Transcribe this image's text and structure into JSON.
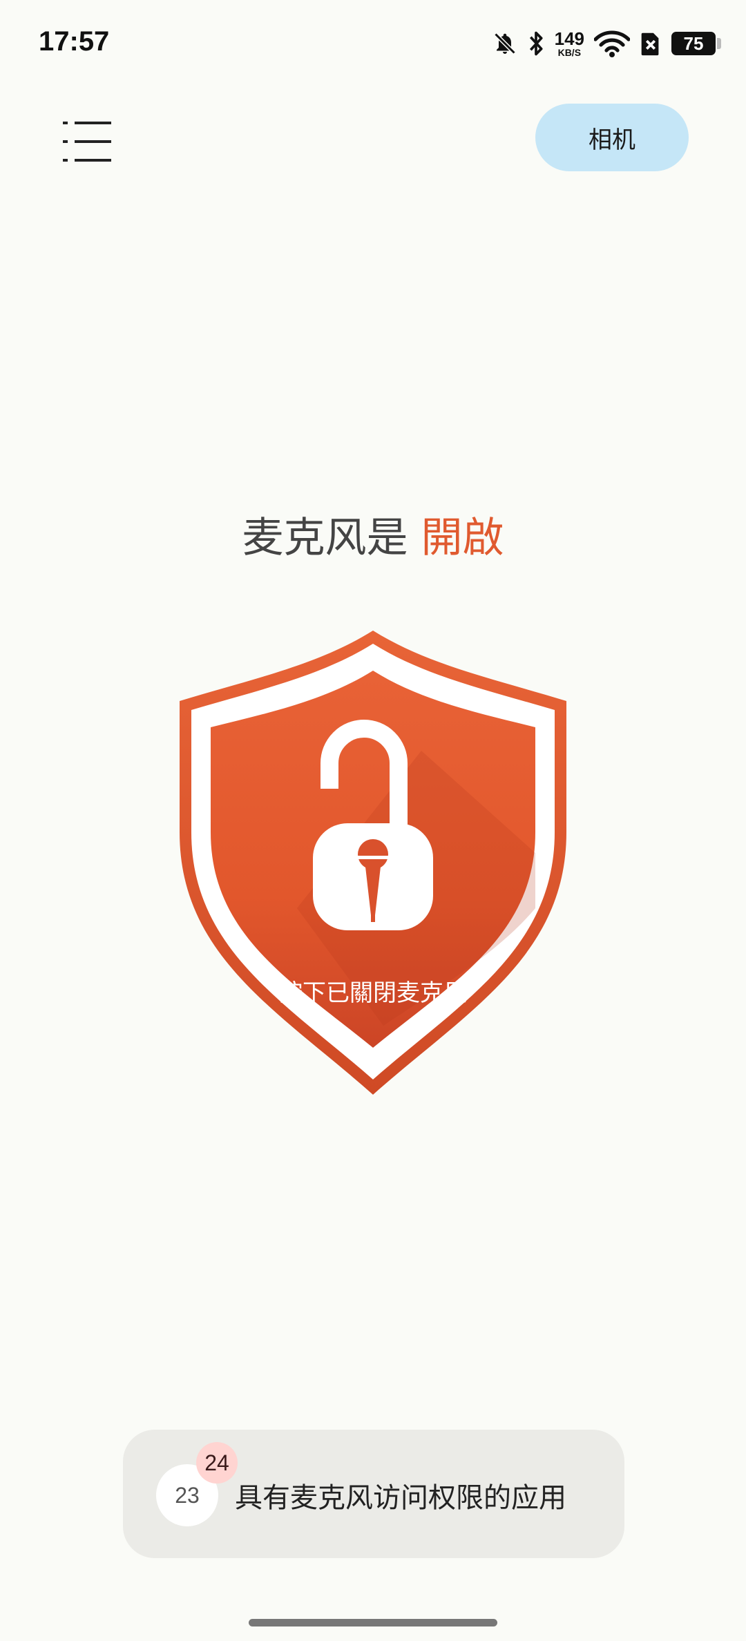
{
  "status_bar": {
    "time": "17:57",
    "net_speed_value": "149",
    "net_speed_unit": "KB/S",
    "battery": "75",
    "icons": [
      "bell-off-icon",
      "bluetooth-icon",
      "wifi-icon",
      "sim-off-icon",
      "battery-icon"
    ]
  },
  "header": {
    "menu_icon": "list-menu-icon",
    "camera_button_label": "相机"
  },
  "main": {
    "status_prefix": "麦克风是 ",
    "status_value": "開啟",
    "shield_label": "按下已關閉麦克风",
    "shield_icon": "unlocked-padlock-microphone-icon"
  },
  "apps_panel": {
    "count": "23",
    "badge": "24",
    "label": "具有麦克风访问权限的应用"
  },
  "colors": {
    "accent": "#e05a2f",
    "camera_button_bg": "#c5e6f7",
    "background": "#fafbf7",
    "panel_bg": "#ebebe7"
  }
}
